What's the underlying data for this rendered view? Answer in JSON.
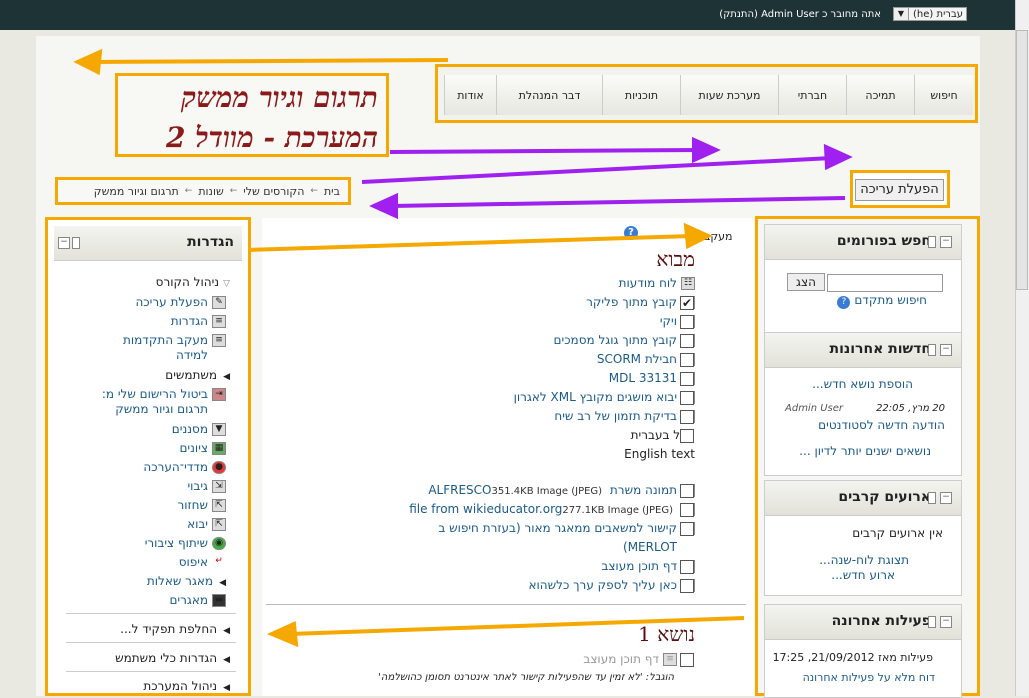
{
  "header": {
    "language": "עברית (he)",
    "login_text": "אתה מחובר כ Admin User (התנתק)"
  },
  "nav": {
    "items": [
      "חיפוש",
      "תמיכה",
      "חברתי",
      "מערכת שעות",
      "תוכניות",
      "דבר המנהלת",
      "אודות"
    ]
  },
  "course_title_line1": "תרגום וגיור ממשק",
  "course_title_line2": "המערכת - מוודל 2",
  "edit_button": "הפעלת עריכה",
  "breadcrumb": [
    "בית",
    "הקורסים שלי",
    "שונות",
    "תרגום וגיור ממשק"
  ],
  "settings_block": {
    "title": "הגדרות",
    "course_admin": "ניהול הקורס",
    "items": [
      {
        "label": "הפעלת עריכה",
        "icon": "edit-icon",
        "link": true
      },
      {
        "label": "הגדרות",
        "icon": "settings-icon",
        "link": true
      },
      {
        "label": "מעקב התקדמות",
        "label2": "למידה",
        "icon": "completion-icon",
        "link": true
      },
      {
        "label": "משתמשים",
        "icon": "users-arrow-icon",
        "link": false
      },
      {
        "label": "ביטול הרישום שלי מ:",
        "label2": "תרגום וגיור ממשק",
        "icon": "unenrol-icon",
        "link": true
      },
      {
        "label": "מסננים",
        "icon": "filter-icon",
        "link": true
      },
      {
        "label": "ציונים",
        "icon": "grades-icon",
        "link": true
      },
      {
        "label": "מדדי־הערכה",
        "icon": "outcomes-icon",
        "link": true
      },
      {
        "label": "גיבוי",
        "icon": "backup-icon",
        "link": true
      },
      {
        "label": "שחזור",
        "icon": "restore-icon",
        "link": true
      },
      {
        "label": "יבוא",
        "icon": "import-icon",
        "link": true
      },
      {
        "label": "שיתוף ציבורי",
        "icon": "publish-icon",
        "link": true
      },
      {
        "label": "איפוס",
        "icon": "reset-icon",
        "link": true
      },
      {
        "label": "מאגר שאלות",
        "icon": "question-bank-icon",
        "link": true
      },
      {
        "label": "מאגרים",
        "icon": "repository-icon",
        "link": true
      }
    ],
    "switch_role": "החלפת תפקיד ל...",
    "profile_settings": "הגדרות כלי משתמש",
    "site_admin": "ניהול המערכת"
  },
  "main": {
    "progress_label": "מעקב",
    "section0_title": "מבוא",
    "activities": [
      {
        "label": "לוח מודעות",
        "icon": "forum-icon",
        "check": null
      },
      {
        "label": "קובץ מתוך פליקר",
        "icon": "image-icon",
        "check": "checked"
      },
      {
        "label": "ויקי",
        "icon": "wiki-icon",
        "check": "empty"
      },
      {
        "label": "קובץ מתוך גוגל מסמכים",
        "icon": "image-icon",
        "check": "empty"
      },
      {
        "label": "חבילת SCORM",
        "icon": "scorm-icon",
        "check": "empty"
      },
      {
        "label": "MDL 33131",
        "icon": "book-icon",
        "check": "empty"
      },
      {
        "label": "יבוא מושגים מקובץ XML לאגרון",
        "icon": "glossary-icon",
        "check": "empty"
      },
      {
        "label": "בדיקת תזמון של רב שיח",
        "icon": "chat-icon",
        "check": "empty"
      },
      {
        "label": "מלל בעברית",
        "icon": "",
        "check": "empty",
        "plain": true
      },
      {
        "label": "English text",
        "icon": "",
        "check": null,
        "plain": true
      }
    ],
    "files": [
      {
        "label": "תמונה משרת ALFRESCO",
        "meta": "351.4KB Image (JPEG)",
        "icon": "image-icon"
      },
      {
        "label": "file from wikieducator.org",
        "meta": "277.1KB Image (JPEG)",
        "icon": "image-icon"
      },
      {
        "label": "קישור למשאבים ממאגר מאור (בעזרת חיפוש ב",
        "label2": "MERLOT)",
        "icon": "page-icon"
      },
      {
        "label": "דף תוכן מעוצב",
        "icon": "page-icon"
      },
      {
        "label": "כאן עליך לספק ערך כלשהוא",
        "icon": "page-icon"
      }
    ],
    "section1_title": "נושא 1",
    "section1_item": "דף תוכן מעוצב",
    "section1_note": "הוגבל: 'לא זמין עד שהפעילות קישור לאתר אינטרנט תסומן כהושלמה'"
  },
  "search_forums": {
    "title": "חפש בפורומים",
    "button": "הצג",
    "advanced": "חיפוש מתקדם"
  },
  "news": {
    "title": "חדשות אחרונות",
    "add_topic": "הוספת נושא חדש...",
    "date": "20 מרץ, 22:05",
    "author": "Admin User",
    "post": "הודעה חדשה לסטודנטים",
    "older": "נושאים ישנים יותר לדיון ..."
  },
  "events": {
    "title": "ארועים קרבים",
    "none": "אין ארועים קרבים",
    "calendar": "תצוגת לוח-שנה...",
    "new_event": "ארוע חדש..."
  },
  "activity": {
    "title": "פעילות אחרונה",
    "since": "פעילות מאז 21/09/2012, 17:25",
    "full_report": "דוח מלא על פעילות אחרונה"
  },
  "colors": {
    "annotation_orange": "#f5a800",
    "annotation_purple": "#a020f0",
    "topbar": "#1d3336",
    "section_title": "#5a0d0d"
  }
}
